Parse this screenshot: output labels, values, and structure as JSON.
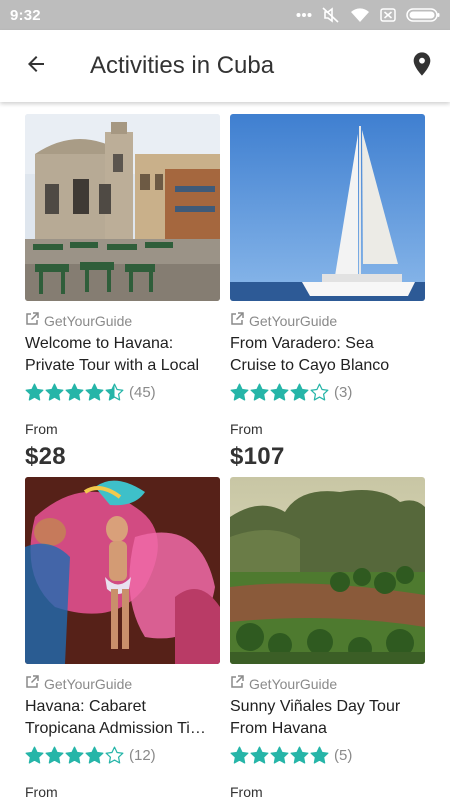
{
  "status_bar": {
    "time": "9:32",
    "icons": [
      "more-dots-icon",
      "mute-icon",
      "wifi-icon",
      "sim-off-icon",
      "battery-icon"
    ]
  },
  "app_bar": {
    "title": "Activities in Cuba",
    "back_icon": "arrow-left-icon",
    "map_icon": "location-pin-icon"
  },
  "colors": {
    "star": "#26b5a8",
    "muted_text": "#8a8a8a",
    "status_bar": "#bdbdbd"
  },
  "activities": [
    {
      "provider": "GetYourGuide",
      "title_line1": "Welcome to Havana:",
      "title_line2": "Private Tour with a Local",
      "rating": 4.5,
      "reviews": "(45)",
      "from_label": "From",
      "price": "$28"
    },
    {
      "provider": "GetYourGuide",
      "title_line1": "From Varadero: Sea",
      "title_line2": "Cruise to Cayo Blanco",
      "rating": 4,
      "reviews": "(3)",
      "from_label": "From",
      "price": "$107"
    },
    {
      "provider": "GetYourGuide",
      "title_line1": "Havana: Cabaret",
      "title_line2": "Tropicana Admission Ti…",
      "rating": 4,
      "reviews": "(12)",
      "from_label": "From",
      "price": ""
    },
    {
      "provider": "GetYourGuide",
      "title_line1": "Sunny Viñales Day Tour",
      "title_line2": "From Havana",
      "rating": 5,
      "reviews": "(5)",
      "from_label": "From",
      "price": ""
    }
  ]
}
